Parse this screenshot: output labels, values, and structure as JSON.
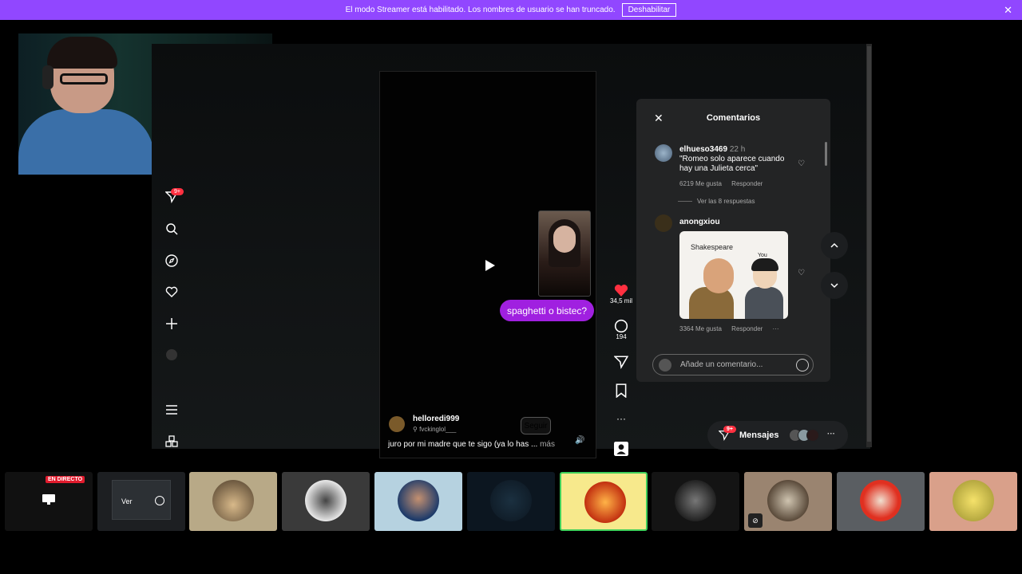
{
  "banner": {
    "message": "El modo Streamer está habilitado. Los nombres de usuario se han truncado.",
    "button_label": "Deshabilitar",
    "close_icon": "close-icon"
  },
  "sidenav": {
    "badge": "9+",
    "items": [
      "send-icon",
      "search-icon",
      "compass-icon",
      "heart-icon",
      "plus-icon",
      "profile-icon",
      "menu-icon",
      "apps-icon"
    ]
  },
  "post": {
    "overlay_text": "spaghetti o bistec?",
    "username": "helloredi999",
    "music": "fvckinglol___",
    "follow_label": "Seguir",
    "caption": "juro por mi madre que te sigo (ya lo has ...",
    "more_label": "más"
  },
  "actions": {
    "likes": "34,5 mil",
    "comments": "194"
  },
  "comments_panel": {
    "title": "Comentarios",
    "comments": [
      {
        "user": "elhueso3469",
        "time": "22 h",
        "text": "\"Romeo solo aparece cuando hay una Julieta cerca\"",
        "likes": "6219 Me gusta",
        "reply_label": "Responder",
        "view_replies": "Ver las 8 respuestas"
      },
      {
        "user": "anongxiou",
        "meme_text_left": "Shakespeare",
        "meme_text_right": "You",
        "likes": "3364 Me gusta",
        "reply_label": "Responder",
        "more_label": "···"
      }
    ],
    "input_placeholder": "Añade un comentario..."
  },
  "messages": {
    "label": "Mensajes",
    "badge": "9+",
    "more": "···"
  },
  "tray": {
    "live_label": "EN DIRECTO",
    "view_label": "Ver"
  },
  "colors": {
    "banner": "#9147ff",
    "bubble": "#a020e0",
    "heart": "#ff3040",
    "panel": "#232425"
  }
}
